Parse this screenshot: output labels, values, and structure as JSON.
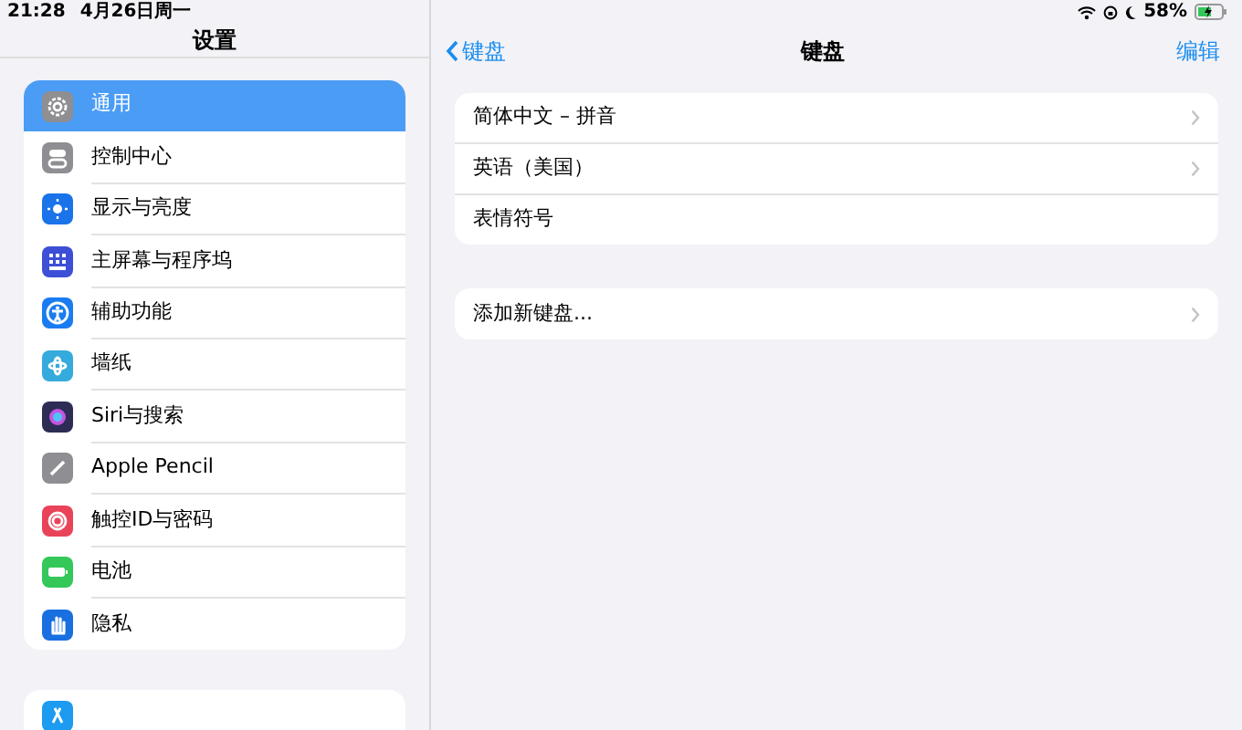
{
  "status_bar": {
    "time": "21:28",
    "date": "4月26日周一",
    "battery": "58%"
  },
  "sidebar": {
    "title": "设置",
    "items": [
      {
        "label": "通用",
        "kind": "gear",
        "color": "#8e8e93",
        "selected": true
      },
      {
        "label": "控制中心",
        "kind": "toggles",
        "color": "#8e8e93",
        "selected": false
      },
      {
        "label": "显示与亮度",
        "kind": "text",
        "color": "#1a73e8",
        "selected": false
      },
      {
        "label": "主屏幕与程序坞",
        "kind": "grid",
        "color": "#3d4fd6",
        "selected": false
      },
      {
        "label": "辅助功能",
        "kind": "person",
        "color": "#1a7cf0",
        "selected": false
      },
      {
        "label": "墙纸",
        "kind": "flower",
        "color": "#35aadc",
        "selected": false
      },
      {
        "label": "Siri与搜索",
        "kind": "siri",
        "color": "#2c2c54",
        "selected": false
      },
      {
        "label": "Apple Pencil",
        "kind": "pencil",
        "color": "#8e8e93",
        "selected": false
      },
      {
        "label": "触控ID与密码",
        "kind": "finger",
        "color": "#e9435a",
        "selected": false
      },
      {
        "label": "电池",
        "kind": "battery",
        "color": "#34c759",
        "selected": false
      },
      {
        "label": "隐私",
        "kind": "hand",
        "color": "#1a6fe0",
        "selected": false
      }
    ],
    "next_group": [
      {
        "kind": "store",
        "color": "#1c9bf0"
      }
    ]
  },
  "detail": {
    "back": "键盘",
    "title": "键盘",
    "action": "编辑",
    "groups": [
      [
        {
          "label": "简体中文 – 拼音",
          "chevron": true
        },
        {
          "label": "英语（美国）",
          "chevron": true
        },
        {
          "label": "表情符号",
          "chevron": false
        }
      ],
      [
        {
          "label": "添加新键盘...",
          "chevron": true
        }
      ]
    ]
  }
}
